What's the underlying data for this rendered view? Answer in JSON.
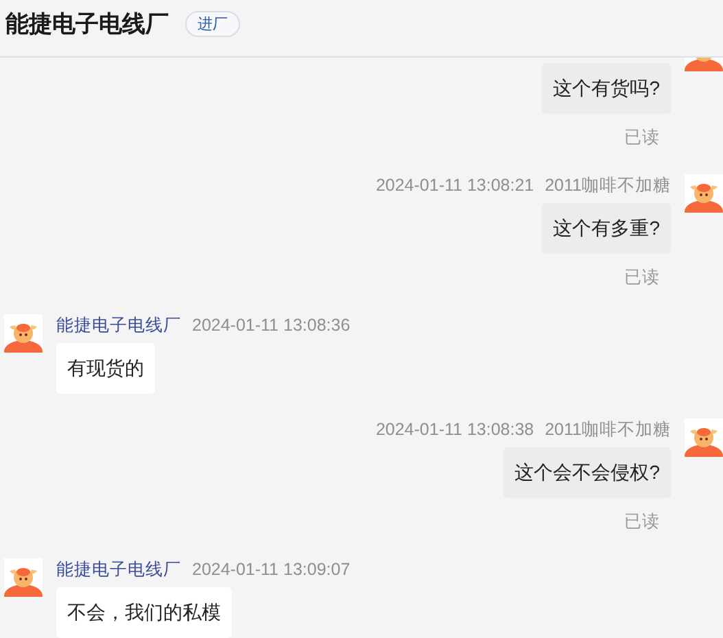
{
  "header": {
    "title": "能捷电子电线厂",
    "badge": "进厂"
  },
  "messages": [
    {
      "kind": "out",
      "text": "这个有货吗?",
      "status": "已读"
    },
    {
      "kind": "out",
      "time": "2024-01-11 13:08:21",
      "sender": "2011咖啡不加糖",
      "text": "这个有多重?",
      "status": "已读"
    },
    {
      "kind": "in",
      "time": "2024-01-11 13:08:36",
      "sender": "能捷电子电线厂",
      "text": "有现货的"
    },
    {
      "kind": "out",
      "time": "2024-01-11 13:08:38",
      "sender": "2011咖啡不加糖",
      "text": "这个会不会侵权?",
      "status": "已读"
    },
    {
      "kind": "in",
      "time": "2024-01-11 13:09:07",
      "sender": "能捷电子电线厂",
      "text": "不会，我们的私模"
    }
  ]
}
